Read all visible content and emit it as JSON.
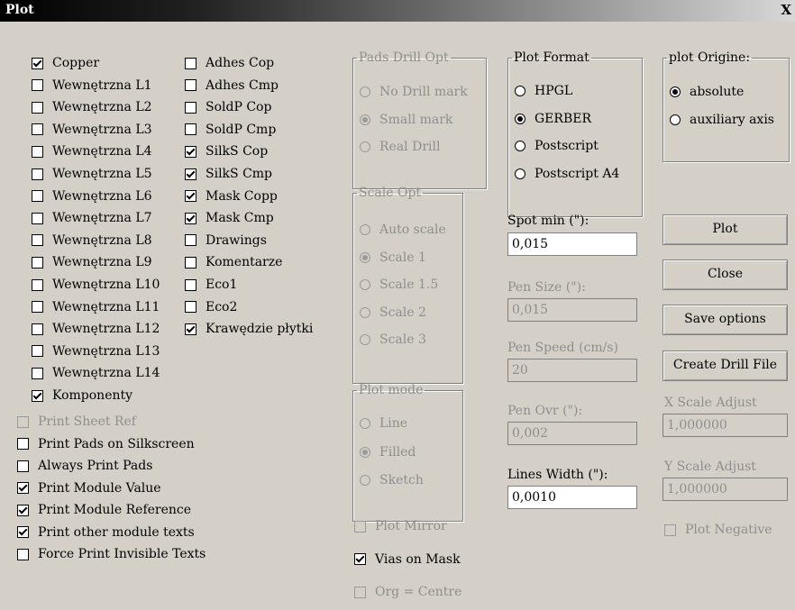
{
  "window": {
    "title": "Plot",
    "close_glyph": "X"
  },
  "layers_col1": [
    {
      "label": "Copper",
      "checked": true
    },
    {
      "label": "Wewnętrzna L1",
      "checked": false
    },
    {
      "label": "Wewnętrzna L2",
      "checked": false
    },
    {
      "label": "Wewnętrzna L3",
      "checked": false
    },
    {
      "label": "Wewnętrzna L4",
      "checked": false
    },
    {
      "label": "Wewnętrzna L5",
      "checked": false
    },
    {
      "label": "Wewnętrzna L6",
      "checked": false
    },
    {
      "label": "Wewnętrzna L7",
      "checked": false
    },
    {
      "label": "Wewnętrzna L8",
      "checked": false
    },
    {
      "label": "Wewnętrzna L9",
      "checked": false
    },
    {
      "label": "Wewnętrzna L10",
      "checked": false
    },
    {
      "label": "Wewnętrzna L11",
      "checked": false
    },
    {
      "label": "Wewnętrzna L12",
      "checked": false
    },
    {
      "label": "Wewnętrzna L13",
      "checked": false
    },
    {
      "label": "Wewnętrzna L14",
      "checked": false
    },
    {
      "label": "Komponenty",
      "checked": true
    }
  ],
  "layers_col2": [
    {
      "label": "Adhes Cop",
      "checked": false
    },
    {
      "label": "Adhes Cmp",
      "checked": false
    },
    {
      "label": "SoldP Cop",
      "checked": false
    },
    {
      "label": "SoldP Cmp",
      "checked": false
    },
    {
      "label": "SilkS Cop",
      "checked": true
    },
    {
      "label": "SilkS Cmp",
      "checked": true
    },
    {
      "label": "Mask Copp",
      "checked": true
    },
    {
      "label": "Mask Cmp",
      "checked": true
    },
    {
      "label": "Drawings",
      "checked": false
    },
    {
      "label": "Komentarze",
      "checked": false
    },
    {
      "label": "Eco1",
      "checked": false
    },
    {
      "label": "Eco2",
      "checked": false
    },
    {
      "label": "Krawędzie płytki",
      "checked": true
    }
  ],
  "print_options": [
    {
      "label": "Print Sheet Ref",
      "checked": false,
      "disabled": true
    },
    {
      "label": "Print Pads on Silkscreen",
      "checked": false,
      "disabled": false
    },
    {
      "label": "Always Print Pads",
      "checked": false,
      "disabled": false
    },
    {
      "label": "Print Module Value",
      "checked": true,
      "disabled": false
    },
    {
      "label": "Print Module Reference",
      "checked": true,
      "disabled": false
    },
    {
      "label": "Print other module texts",
      "checked": true,
      "disabled": false
    },
    {
      "label": "Force Print Invisible Texts",
      "checked": false,
      "disabled": false
    }
  ],
  "pads_drill": {
    "title": "Pads Drill Opt",
    "options": [
      "No Drill mark",
      "Small mark",
      "Real Drill"
    ],
    "selected": 1
  },
  "scale_opt": {
    "title": "Scale Opt",
    "options": [
      "Auto scale",
      "Scale 1",
      "Scale 1.5",
      "Scale 2",
      "Scale 3"
    ],
    "selected": 1
  },
  "plot_mode": {
    "title": "Plot mode",
    "options": [
      "Line",
      "Filled",
      "Sketch"
    ],
    "selected": 1
  },
  "mid_checks": [
    {
      "label": "Plot Mirror",
      "checked": false,
      "disabled": true
    },
    {
      "label": "Vias on Mask",
      "checked": true,
      "disabled": false
    },
    {
      "label": "Org = Centre",
      "checked": false,
      "disabled": true
    }
  ],
  "plot_format": {
    "title": "Plot Format",
    "options": [
      "HPGL",
      "GERBER",
      "Postscript",
      "Postscript A4"
    ],
    "selected": 1
  },
  "plot_origin": {
    "title": "plot Origine:",
    "options": [
      "absolute",
      "auxiliary axis"
    ],
    "selected": 0
  },
  "fields": {
    "spot_min": {
      "label": "Spot min (\"):",
      "value": "0,015"
    },
    "pen_size": {
      "label": "Pen Size (\"):",
      "value": "0,015"
    },
    "pen_speed": {
      "label": "Pen Speed (cm/s)",
      "value": "20"
    },
    "pen_ovr": {
      "label": "Pen Ovr (\"):",
      "value": "0,002"
    },
    "lines_width": {
      "label": "Lines Width (\"):",
      "value": "0,0010"
    },
    "x_scale": {
      "label": "X Scale Adjust",
      "value": "1,000000"
    },
    "y_scale": {
      "label": "Y Scale Adjust",
      "value": "1,000000"
    }
  },
  "buttons": {
    "plot": "Plot",
    "close": "Close",
    "save": "Save options",
    "drill": "Create Drill File"
  },
  "plot_negative": {
    "label": "Plot Negative",
    "checked": false
  }
}
